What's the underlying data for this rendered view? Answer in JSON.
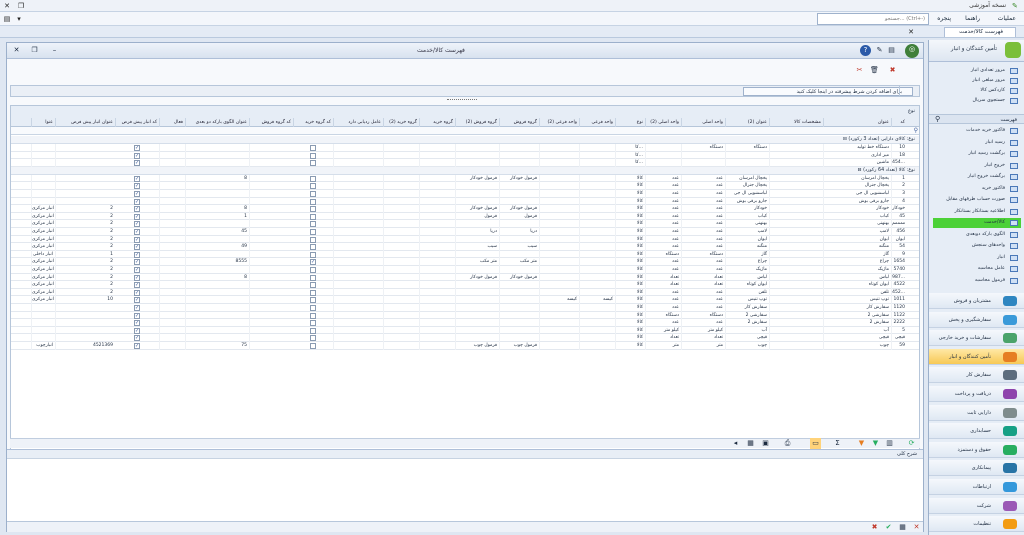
{
  "app_title": "نسخه آموزشی",
  "menu": {
    "items": [
      "عملیات",
      "راهنما",
      "پنجره"
    ],
    "search_placeholder": "جستجو... (Ctrl+-)"
  },
  "doc_tab": "فهرست کالا/خدمت",
  "panel_title": "فهرست کالا/خدمت",
  "filter_text": "برای اضافه کردن شرط پیشرفته در اینجا کلیک کنید",
  "group_by": "نوع",
  "columns": [
    "کد",
    "عنوان",
    "مشخصات کالا",
    "عنوان (2)",
    "واحد اصلی",
    "واحد اصلی (2)",
    "نوع",
    "واحد فرعی",
    "واحد فرعی (2)",
    "گروه فروش",
    "گروه فروش (2)",
    "گروه خرید",
    "گروه خرید (2)",
    "عامل ردیابی دارد",
    "کد گروه خرید",
    "کد گروه فروش",
    "عنوان الگوی بارکد دو بعدی",
    "فعال",
    "کد انبار پیش فرض",
    "عنوان انبار پیش فرض",
    "عنوا"
  ],
  "groups": [
    {
      "label": "نوع: کالای دارایی (تعداد 3 رکورد)",
      "rows": [
        [
          "10",
          "دستگاه خط تولید",
          "",
          "دستگاه",
          "دستگاه",
          "",
          "کا...",
          "",
          "",
          "",
          "",
          "",
          "",
          "",
          false,
          "",
          "",
          "",
          true,
          "",
          ""
        ],
        [
          "18",
          "میز اداری",
          "",
          "",
          "",
          "",
          "کا...",
          "",
          "",
          "",
          "",
          "",
          "",
          "",
          false,
          "",
          "",
          "",
          true,
          "",
          ""
        ],
        [
          "454...",
          "ماشین",
          "",
          "",
          "",
          "",
          "کا...",
          "",
          "",
          "",
          "",
          "",
          "",
          "",
          false,
          "",
          "",
          "",
          true,
          "",
          ""
        ]
      ]
    },
    {
      "label": "نوع: کالا (تعداد 64 رکورد)",
      "rows": [
        [
          "1",
          "یخچال امرسان",
          "",
          "یخچال امرسان",
          "عدد",
          "عدد",
          "کالا",
          "",
          "",
          "فرمول خودکار",
          "فرمول خودکار",
          "",
          "",
          "",
          false,
          "",
          "8",
          "",
          true,
          "",
          "",
          ""
        ],
        [
          "2",
          "یخچال جنرال",
          "",
          "یخچال جنرال",
          "عدد",
          "عدد",
          "کالا",
          "",
          "",
          "",
          "",
          "",
          "",
          "",
          false,
          "",
          "",
          "",
          true,
          "",
          "",
          ""
        ],
        [
          "3",
          "لباسشویی ال جی",
          "",
          "لباسشویی ال جی",
          "عدد",
          "عدد",
          "کالا",
          "",
          "",
          "",
          "",
          "",
          "",
          "",
          false,
          "",
          "",
          "",
          true,
          "",
          "",
          ""
        ],
        [
          "4",
          "جارو برقی بوش",
          "",
          "جارو برقی بوش",
          "عدد",
          "عدد",
          "کالا",
          "",
          "",
          "",
          "",
          "",
          "",
          "",
          false,
          "",
          "",
          "",
          true,
          "",
          "",
          ""
        ],
        [
          "خودکار",
          "خودکار",
          "",
          "خودکار",
          "عدد",
          "عدد",
          "کالا",
          "",
          "",
          "فرمول خودکار",
          "فرمول خودکار",
          "",
          "",
          "",
          false,
          "",
          "8",
          "",
          true,
          "2",
          "انبار مرکزی",
          "انبار"
        ],
        [
          "45",
          "کباب",
          "",
          "کباب",
          "عدد",
          "عدد",
          "کالا",
          "",
          "",
          "فرمول",
          "فرمول",
          "",
          "",
          "",
          false,
          "",
          "1",
          "",
          true,
          "2",
          "انبار مرکزی",
          "انبار"
        ],
        [
          "ممممم",
          "بهنهنی",
          "",
          "بهنهنی",
          "عدد",
          "عدد",
          "کالا",
          "",
          "",
          "",
          "",
          "",
          "",
          "",
          false,
          "",
          "",
          "",
          true,
          "2",
          "انبار مرکزی",
          "انبار"
        ],
        [
          "456",
          "لامپ",
          "",
          "لامپ",
          "عدد",
          "عدد",
          "کالا",
          "",
          "",
          "دریا",
          "دریا",
          "",
          "",
          "",
          false,
          "",
          "45",
          "",
          true,
          "2",
          "انبار مرکزی",
          "انبار"
        ],
        [
          "ایوان",
          "ایوان",
          "",
          "ایوان",
          "عدد",
          "عدد",
          "کالا",
          "",
          "",
          "",
          "",
          "",
          "",
          "",
          false,
          "",
          "",
          "",
          true,
          "2",
          "انبار مرکزی",
          "انبار"
        ],
        [
          "54",
          "منگنه",
          "",
          "منگنه",
          "عدد",
          "عدد",
          "کالا",
          "",
          "",
          "سیب",
          "سیب",
          "",
          "",
          "",
          false,
          "",
          "49",
          "",
          true,
          "2",
          "انبار مرکزی",
          "انبار"
        ],
        [
          "9",
          "گاز",
          "",
          "گاز",
          "دستگاه",
          "دستگاه",
          "کالا",
          "",
          "",
          "",
          "",
          "",
          "",
          "",
          false,
          "",
          "",
          "",
          true,
          "1",
          "انبار داخلی",
          "انبار"
        ],
        [
          "1654",
          "چراغ",
          "",
          "چراغ",
          "عدد",
          "عدد",
          "کالا",
          "",
          "",
          "متر مکب",
          "متر مکب",
          "",
          "",
          "",
          true,
          "",
          "8555",
          "",
          true,
          "2",
          "انبار مرکزی",
          "انبار"
        ],
        [
          "5740",
          "ماژیک",
          "",
          "ماژیک",
          "عدد",
          "عدد",
          "کالا",
          "",
          "",
          "",
          "",
          "",
          "",
          "",
          false,
          "",
          "",
          "",
          true,
          "2",
          "انبار مرکزی",
          "انبار"
        ],
        [
          "987...",
          "لباس",
          "",
          "لباس",
          "تعداد",
          "تعداد",
          "کالا",
          "",
          "",
          "فرمول خودکار",
          "فرمول خودکار",
          "",
          "",
          "",
          false,
          "",
          "8",
          "",
          true,
          "2",
          "انبار مرکزی",
          "انبار"
        ],
        [
          "4522",
          "ایوان کوتاه",
          "",
          "ایوان کوتاه",
          "تعداد",
          "تعداد",
          "کالا",
          "",
          "",
          "",
          "",
          "",
          "",
          "",
          false,
          "",
          "",
          "",
          true,
          "2",
          "انبار مرکزی",
          "انبار"
        ],
        [
          "452...",
          "تلفن",
          "",
          "تلفن",
          "عدد",
          "عدد",
          "کالا",
          "",
          "",
          "",
          "",
          "",
          "",
          "",
          false,
          "",
          "",
          "",
          true,
          "2",
          "انبار مرکزی",
          "انبار"
        ],
        [
          "1011",
          "توپ تنیس",
          "",
          "توپ تنیس",
          "عدد",
          "عدد",
          "کالا",
          "کیسه",
          "کیسه",
          "",
          "",
          "",
          "",
          "",
          false,
          "",
          "",
          "",
          true,
          "10",
          "انبار مرکزی",
          "انبار"
        ],
        [
          "1120",
          "سفارش کار",
          "",
          "سفارش کار",
          "عدد",
          "عدد",
          "کالا",
          "",
          "",
          "",
          "",
          "",
          "",
          "",
          false,
          "",
          "",
          "",
          true,
          "",
          "",
          ""
        ],
        [
          "1122",
          "سفارشی 2",
          "",
          "سفارشی 2",
          "دستگاه",
          "دستگاه",
          "کالا",
          "",
          "",
          "",
          "",
          "",
          "",
          "",
          false,
          "",
          "",
          "",
          true,
          "",
          "",
          ""
        ],
        [
          "2222",
          "سفارش 2",
          "",
          "سفارش 2",
          "عدد",
          "عدد",
          "کالا",
          "",
          "",
          "",
          "",
          "",
          "",
          "",
          false,
          "",
          "",
          "",
          true,
          "",
          "",
          ""
        ],
        [
          "5",
          "آب",
          "",
          "آب",
          "کیلو متر",
          "کیلو متر",
          "کالا",
          "",
          "",
          "",
          "",
          "",
          "",
          "",
          false,
          "",
          "",
          "",
          true,
          "",
          "",
          ""
        ],
        [
          "قیچی",
          "قیچی",
          "",
          "قیچی",
          "تعداد",
          "تعداد",
          "کالا",
          "",
          "",
          "",
          "",
          "",
          "",
          "",
          false,
          "",
          "",
          "",
          true,
          "",
          "",
          ""
        ],
        [
          "59",
          "چوب",
          "",
          "چوب",
          "متر",
          "متر",
          "کالا",
          "",
          "",
          "فرمول چوب",
          "فرمول چوب",
          "",
          "",
          "",
          false,
          "",
          "75",
          "",
          true,
          "4521369",
          "انبارچوب",
          "انباره"
        ]
      ]
    }
  ],
  "memo_label": "شرح کلی",
  "side": {
    "header": "تأمین کنندگان و انبار",
    "search_label": "فهرست",
    "top_items": [
      "مرور تعدادی انبار",
      "مرور مبلغی انبار",
      "کاردکس کالا",
      "جستجوی سریال"
    ],
    "list_items": [
      "فاکتور خرید خدمات",
      "رسید انبار",
      "برگشت رسید انبار",
      "خروج انبار",
      "برگشت خروج انبار",
      "فاکتور خرید",
      "صورت حساب طرفهای مقابل",
      "اطلاعیه بستانکار بستانکار",
      "کالا/خدمت",
      "الگوی بارکد دوبعدی",
      "واحدهای سنجش",
      "انبار",
      "عامل محاسبه",
      "فرمول محاسبه"
    ],
    "categories": [
      "مشتریان و فروش",
      "سفارشگیری و پخش",
      "سفارشات و خرید خارجی",
      "تأمین کنندگان و انبار",
      "سفارش کار",
      "دریافت و پرداخت",
      "دارایی ثابت",
      "حسابداری",
      "حقوق و دستمزد",
      "پیمانکاری",
      "ارتباطات",
      "شرکت",
      "تنظیمات"
    ]
  },
  "colors": {
    "accent": "#f7c955",
    "selected_item": "#4cd137",
    "header": "#e6edf6"
  }
}
